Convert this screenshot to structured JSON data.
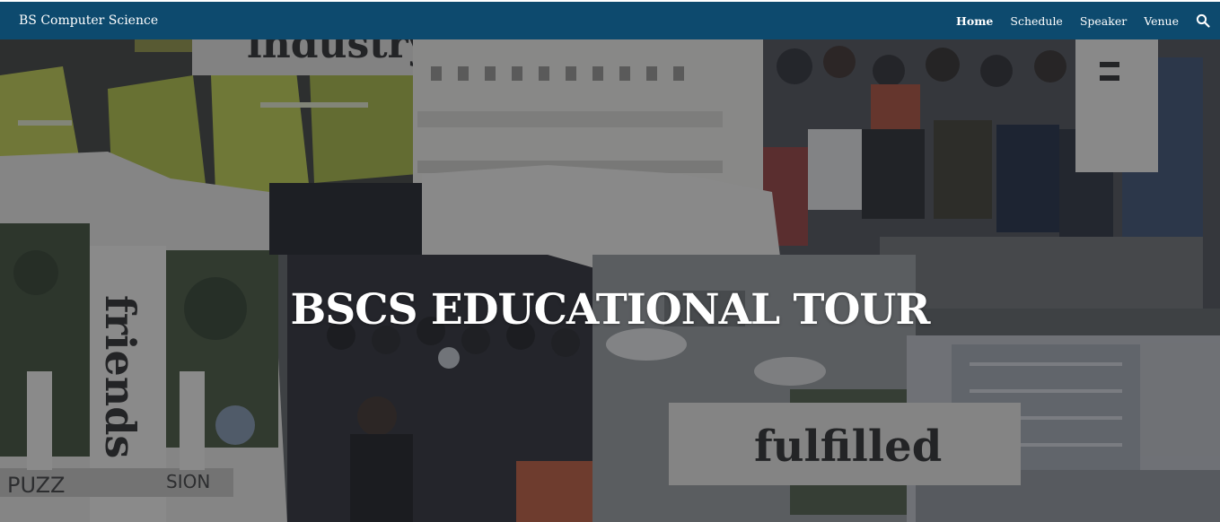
{
  "navbar": {
    "brand": "BS Computer Science",
    "links": [
      {
        "label": "Home",
        "active": true
      },
      {
        "label": "Schedule",
        "active": false
      },
      {
        "label": "Speaker",
        "active": false
      },
      {
        "label": "Venue",
        "active": false
      }
    ],
    "search_icon": "search-icon",
    "bg_color": "#0d4a6e"
  },
  "hero": {
    "title": "BSCS EDUCATIONAL TOUR",
    "collage_words": {
      "industry": "industry",
      "friends": "friends",
      "fulfilled": "fulfilled",
      "sign_left": "PUZZ",
      "sign_right": "SION"
    }
  }
}
